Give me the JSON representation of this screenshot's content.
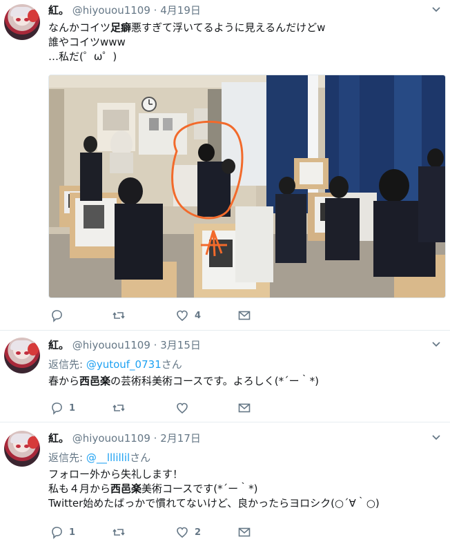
{
  "tweets": [
    {
      "name": "紅。",
      "handle": "@hiyouou1109",
      "sep": "·",
      "date": "4月19日",
      "lines": [
        [
          "なんかコイツ",
          "足癖",
          "悪すぎて浮いてるように見えるんだけどw"
        ],
        [
          "誰やコイツwww"
        ],
        [
          "…私だ(゜ω゜)"
        ]
      ],
      "counts": {
        "reply": "",
        "retweet": "",
        "like": "4"
      }
    },
    {
      "name": "紅。",
      "handle": "@hiyouou1109",
      "sep": "·",
      "date": "3月15日",
      "reply_prefix": "返信先: ",
      "reply_to": "@yutouf_0731",
      "reply_suffix": "さん",
      "lines": [
        [
          "春から",
          "西邑楽",
          "の芸術科美術コースです。よろしく(*´ー｀*)"
        ]
      ],
      "counts": {
        "reply": "1",
        "retweet": "",
        "like": ""
      }
    },
    {
      "name": "紅。",
      "handle": "@hiyouou1109",
      "sep": "·",
      "date": "2月17日",
      "reply_prefix": "返信先: ",
      "reply_to": "@__lllillil",
      "reply_suffix": "さん",
      "lines": [
        [
          "フォロー外から失礼します！"
        ],
        [
          "私も４月から",
          "西邑楽",
          "美術コースです(*´ー｀*)"
        ],
        [
          "Twitter始めたばっかで慣れてないけど、良かったらヨロシク(○´∀｀○)"
        ]
      ],
      "counts": {
        "reply": "1",
        "retweet": "",
        "like": "2"
      }
    }
  ],
  "colors": {
    "accent": "#1da1f2",
    "muted": "#657786",
    "annotation": "#f26a2b"
  },
  "icons": [
    "reply-icon",
    "retweet-icon",
    "like-icon",
    "message-icon",
    "chevron-down-icon"
  ]
}
